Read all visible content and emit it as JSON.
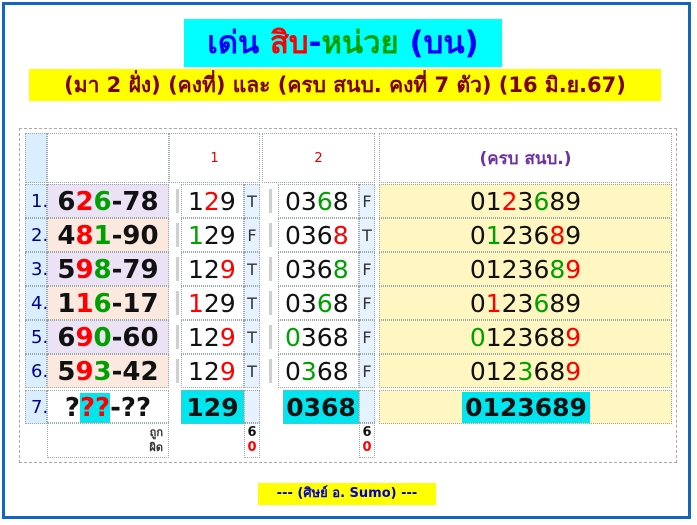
{
  "title": {
    "part1": "เด่น ",
    "part2": "สิบ",
    "part3": "-",
    "part4": "หน่วย",
    "part5": " (บน)"
  },
  "subtitle": "(มา 2 ฝั่ง) (คงที่) และ (ครบ สนบ. คงที่ 7 ตัว) (16 มิ.ย.67)",
  "headers": {
    "col1": "1",
    "col2": "2",
    "col3": "(ครบ สนบ.)"
  },
  "rows": [
    {
      "no": "1.",
      "pick": [
        {
          "t": "6",
          "c": "black"
        },
        {
          "t": "2",
          "c": "red"
        },
        {
          "t": "6",
          "c": "green"
        },
        {
          "t": "-78",
          "c": "black"
        }
      ],
      "set1": [
        {
          "t": "1",
          "c": "black"
        },
        {
          "t": "2",
          "c": "red"
        },
        {
          "t": "9",
          "c": "black"
        }
      ],
      "tf1": "T",
      "set2": [
        {
          "t": "03",
          "c": "black"
        },
        {
          "t": "6",
          "c": "green"
        },
        {
          "t": "8",
          "c": "black"
        }
      ],
      "tf2": "F",
      "full": [
        {
          "t": "01",
          "c": "black"
        },
        {
          "t": "2",
          "c": "red"
        },
        {
          "t": "3",
          "c": "black"
        },
        {
          "t": "6",
          "c": "green"
        },
        {
          "t": "89",
          "c": "black"
        }
      ]
    },
    {
      "no": "2.",
      "pick": [
        {
          "t": "4",
          "c": "black"
        },
        {
          "t": "8",
          "c": "red"
        },
        {
          "t": "1",
          "c": "green"
        },
        {
          "t": "-90",
          "c": "black"
        }
      ],
      "set1": [
        {
          "t": "1",
          "c": "green"
        },
        {
          "t": "29",
          "c": "black"
        }
      ],
      "tf1": "F",
      "set2": [
        {
          "t": "036",
          "c": "black"
        },
        {
          "t": "8",
          "c": "red"
        }
      ],
      "tf2": "T",
      "full": [
        {
          "t": "0",
          "c": "black"
        },
        {
          "t": "1",
          "c": "green"
        },
        {
          "t": "23",
          "c": "black"
        },
        {
          "t": "6",
          "c": "black"
        },
        {
          "t": "8",
          "c": "red"
        },
        {
          "t": "9",
          "c": "black"
        }
      ]
    },
    {
      "no": "3.",
      "pick": [
        {
          "t": "5",
          "c": "black"
        },
        {
          "t": "9",
          "c": "red"
        },
        {
          "t": "8",
          "c": "green"
        },
        {
          "t": "-79",
          "c": "black"
        }
      ],
      "set1": [
        {
          "t": "12",
          "c": "black"
        },
        {
          "t": "9",
          "c": "red"
        }
      ],
      "tf1": "T",
      "set2": [
        {
          "t": "036",
          "c": "black"
        },
        {
          "t": "8",
          "c": "green"
        }
      ],
      "tf2": "F",
      "full": [
        {
          "t": "01236",
          "c": "black"
        },
        {
          "t": "8",
          "c": "green"
        },
        {
          "t": "9",
          "c": "red"
        }
      ]
    },
    {
      "no": "4.",
      "pick": [
        {
          "t": "1",
          "c": "black"
        },
        {
          "t": "1",
          "c": "red"
        },
        {
          "t": "6",
          "c": "green"
        },
        {
          "t": "-17",
          "c": "black"
        }
      ],
      "set1": [
        {
          "t": "1",
          "c": "red"
        },
        {
          "t": "29",
          "c": "black"
        }
      ],
      "tf1": "T",
      "set2": [
        {
          "t": "03",
          "c": "black"
        },
        {
          "t": "6",
          "c": "green"
        },
        {
          "t": "8",
          "c": "black"
        }
      ],
      "tf2": "F",
      "full": [
        {
          "t": "0",
          "c": "black"
        },
        {
          "t": "1",
          "c": "red"
        },
        {
          "t": "23",
          "c": "black"
        },
        {
          "t": "6",
          "c": "green"
        },
        {
          "t": "89",
          "c": "black"
        }
      ]
    },
    {
      "no": "5.",
      "pick": [
        {
          "t": "6",
          "c": "black"
        },
        {
          "t": "9",
          "c": "red"
        },
        {
          "t": "0",
          "c": "green"
        },
        {
          "t": "-60",
          "c": "black"
        }
      ],
      "set1": [
        {
          "t": "12",
          "c": "black"
        },
        {
          "t": "9",
          "c": "red"
        }
      ],
      "tf1": "T",
      "set2": [
        {
          "t": "0",
          "c": "green"
        },
        {
          "t": "368",
          "c": "black"
        }
      ],
      "tf2": "F",
      "full": [
        {
          "t": "0",
          "c": "green"
        },
        {
          "t": "12368",
          "c": "black"
        },
        {
          "t": "9",
          "c": "red"
        }
      ]
    },
    {
      "no": "6.",
      "pick": [
        {
          "t": "5",
          "c": "black"
        },
        {
          "t": "9",
          "c": "red"
        },
        {
          "t": "3",
          "c": "green"
        },
        {
          "t": "-42",
          "c": "black"
        }
      ],
      "set1": [
        {
          "t": "12",
          "c": "black"
        },
        {
          "t": "9",
          "c": "red"
        }
      ],
      "tf1": "T",
      "set2": [
        {
          "t": "0",
          "c": "black"
        },
        {
          "t": "3",
          "c": "green"
        },
        {
          "t": "68",
          "c": "black"
        }
      ],
      "tf2": "F",
      "full": [
        {
          "t": "012",
          "c": "black"
        },
        {
          "t": "3",
          "c": "green"
        },
        {
          "t": "68",
          "c": "black"
        },
        {
          "t": "9",
          "c": "red"
        }
      ]
    }
  ],
  "last_row": {
    "no": "7.",
    "pick": [
      {
        "t": "?",
        "c": "black"
      },
      {
        "t": "??",
        "c": "red"
      },
      {
        "t": "-??",
        "c": "black"
      }
    ],
    "set1": "129",
    "set2": "0368",
    "full": "0123689"
  },
  "footer": {
    "label1": "ถูก",
    "label2": "ผิด",
    "c1_right": "6",
    "c1_wrong": "0",
    "c2_right": "6",
    "c2_wrong": "0"
  },
  "signature": "--- (ศิษย์ อ. Sumo) ---",
  "colors": {
    "black": "#111111",
    "red": "#ff0000",
    "green": "#00a000",
    "highlight": "#00e5ee",
    "title_bg": "#00ffff",
    "sub_bg": "#ffff00"
  }
}
